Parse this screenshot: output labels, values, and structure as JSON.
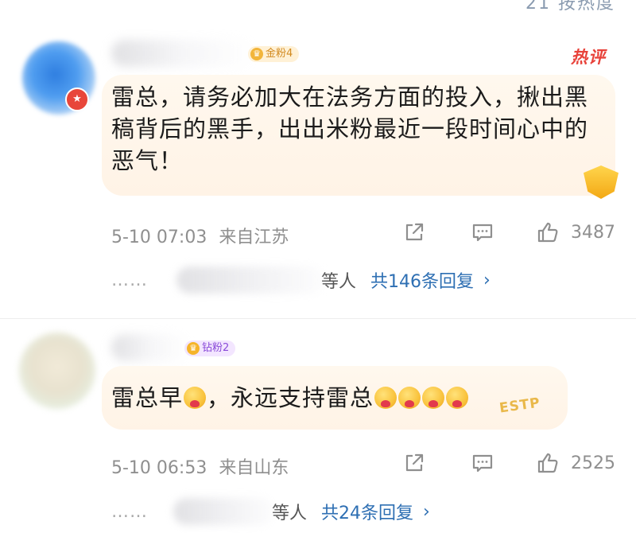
{
  "header": {
    "sort_label": "21 按热度"
  },
  "comments": [
    {
      "fan_badge": "金粉4",
      "hot_tag": "热评",
      "text": "雷总，请务必加大在法务方面的投入，揪出黑稿背后的黑手，出出米粉最近一段时间心中的恶气！",
      "timestamp": "5-10 07:03",
      "location": "来自江苏",
      "like_count": "3487",
      "replies_suffix": "等人",
      "replies_link": "共146条回复"
    },
    {
      "fan_badge": "钻粉2",
      "text_main": "雷总早",
      "text_rest": "，永远支持雷总",
      "timestamp": "5-10 06:53",
      "location": "来自山东",
      "like_count": "2525",
      "replies_suffix": "等人",
      "replies_link": "共24条回复"
    }
  ],
  "icons": {
    "share": "share-icon",
    "reply": "comment-icon",
    "like": "thumbs-up-icon",
    "chevron": "chevron-right-icon"
  },
  "colors": {
    "hot": "#e8423a",
    "link": "#2e6fb3",
    "bubble": "#fff5e8"
  }
}
